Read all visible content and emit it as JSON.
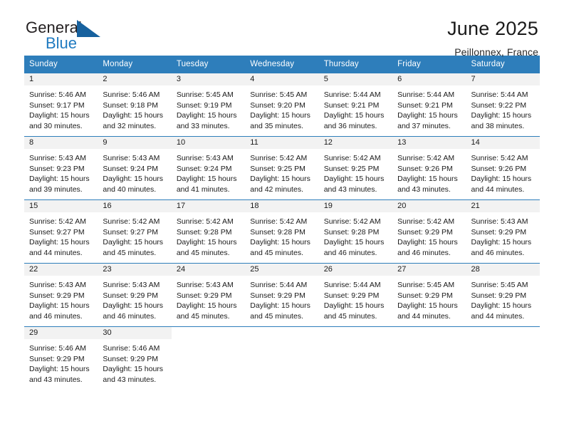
{
  "brand": {
    "name_top": "General",
    "name_bottom": "Blue",
    "accent_color": "#1f7ac0",
    "flag_color": "#17619e"
  },
  "header": {
    "title": "June 2025",
    "subtitle": "Peillonnex, France"
  },
  "theme": {
    "header_bg": "#2e7ebb",
    "daynum_bg": "#f2f2f2",
    "text_color": "#1a1a1a"
  },
  "calendar": {
    "weekday_headers": [
      "Sunday",
      "Monday",
      "Tuesday",
      "Wednesday",
      "Thursday",
      "Friday",
      "Saturday"
    ],
    "weeks": [
      [
        {
          "day": "1",
          "sunrise": "Sunrise: 5:46 AM",
          "sunset": "Sunset: 9:17 PM",
          "daylight_line1": "Daylight: 15 hours",
          "daylight_line2": "and 30 minutes."
        },
        {
          "day": "2",
          "sunrise": "Sunrise: 5:46 AM",
          "sunset": "Sunset: 9:18 PM",
          "daylight_line1": "Daylight: 15 hours",
          "daylight_line2": "and 32 minutes."
        },
        {
          "day": "3",
          "sunrise": "Sunrise: 5:45 AM",
          "sunset": "Sunset: 9:19 PM",
          "daylight_line1": "Daylight: 15 hours",
          "daylight_line2": "and 33 minutes."
        },
        {
          "day": "4",
          "sunrise": "Sunrise: 5:45 AM",
          "sunset": "Sunset: 9:20 PM",
          "daylight_line1": "Daylight: 15 hours",
          "daylight_line2": "and 35 minutes."
        },
        {
          "day": "5",
          "sunrise": "Sunrise: 5:44 AM",
          "sunset": "Sunset: 9:21 PM",
          "daylight_line1": "Daylight: 15 hours",
          "daylight_line2": "and 36 minutes."
        },
        {
          "day": "6",
          "sunrise": "Sunrise: 5:44 AM",
          "sunset": "Sunset: 9:21 PM",
          "daylight_line1": "Daylight: 15 hours",
          "daylight_line2": "and 37 minutes."
        },
        {
          "day": "7",
          "sunrise": "Sunrise: 5:44 AM",
          "sunset": "Sunset: 9:22 PM",
          "daylight_line1": "Daylight: 15 hours",
          "daylight_line2": "and 38 minutes."
        }
      ],
      [
        {
          "day": "8",
          "sunrise": "Sunrise: 5:43 AM",
          "sunset": "Sunset: 9:23 PM",
          "daylight_line1": "Daylight: 15 hours",
          "daylight_line2": "and 39 minutes."
        },
        {
          "day": "9",
          "sunrise": "Sunrise: 5:43 AM",
          "sunset": "Sunset: 9:24 PM",
          "daylight_line1": "Daylight: 15 hours",
          "daylight_line2": "and 40 minutes."
        },
        {
          "day": "10",
          "sunrise": "Sunrise: 5:43 AM",
          "sunset": "Sunset: 9:24 PM",
          "daylight_line1": "Daylight: 15 hours",
          "daylight_line2": "and 41 minutes."
        },
        {
          "day": "11",
          "sunrise": "Sunrise: 5:42 AM",
          "sunset": "Sunset: 9:25 PM",
          "daylight_line1": "Daylight: 15 hours",
          "daylight_line2": "and 42 minutes."
        },
        {
          "day": "12",
          "sunrise": "Sunrise: 5:42 AM",
          "sunset": "Sunset: 9:25 PM",
          "daylight_line1": "Daylight: 15 hours",
          "daylight_line2": "and 43 minutes."
        },
        {
          "day": "13",
          "sunrise": "Sunrise: 5:42 AM",
          "sunset": "Sunset: 9:26 PM",
          "daylight_line1": "Daylight: 15 hours",
          "daylight_line2": "and 43 minutes."
        },
        {
          "day": "14",
          "sunrise": "Sunrise: 5:42 AM",
          "sunset": "Sunset: 9:26 PM",
          "daylight_line1": "Daylight: 15 hours",
          "daylight_line2": "and 44 minutes."
        }
      ],
      [
        {
          "day": "15",
          "sunrise": "Sunrise: 5:42 AM",
          "sunset": "Sunset: 9:27 PM",
          "daylight_line1": "Daylight: 15 hours",
          "daylight_line2": "and 44 minutes."
        },
        {
          "day": "16",
          "sunrise": "Sunrise: 5:42 AM",
          "sunset": "Sunset: 9:27 PM",
          "daylight_line1": "Daylight: 15 hours",
          "daylight_line2": "and 45 minutes."
        },
        {
          "day": "17",
          "sunrise": "Sunrise: 5:42 AM",
          "sunset": "Sunset: 9:28 PM",
          "daylight_line1": "Daylight: 15 hours",
          "daylight_line2": "and 45 minutes."
        },
        {
          "day": "18",
          "sunrise": "Sunrise: 5:42 AM",
          "sunset": "Sunset: 9:28 PM",
          "daylight_line1": "Daylight: 15 hours",
          "daylight_line2": "and 45 minutes."
        },
        {
          "day": "19",
          "sunrise": "Sunrise: 5:42 AM",
          "sunset": "Sunset: 9:28 PM",
          "daylight_line1": "Daylight: 15 hours",
          "daylight_line2": "and 46 minutes."
        },
        {
          "day": "20",
          "sunrise": "Sunrise: 5:42 AM",
          "sunset": "Sunset: 9:29 PM",
          "daylight_line1": "Daylight: 15 hours",
          "daylight_line2": "and 46 minutes."
        },
        {
          "day": "21",
          "sunrise": "Sunrise: 5:43 AM",
          "sunset": "Sunset: 9:29 PM",
          "daylight_line1": "Daylight: 15 hours",
          "daylight_line2": "and 46 minutes."
        }
      ],
      [
        {
          "day": "22",
          "sunrise": "Sunrise: 5:43 AM",
          "sunset": "Sunset: 9:29 PM",
          "daylight_line1": "Daylight: 15 hours",
          "daylight_line2": "and 46 minutes."
        },
        {
          "day": "23",
          "sunrise": "Sunrise: 5:43 AM",
          "sunset": "Sunset: 9:29 PM",
          "daylight_line1": "Daylight: 15 hours",
          "daylight_line2": "and 46 minutes."
        },
        {
          "day": "24",
          "sunrise": "Sunrise: 5:43 AM",
          "sunset": "Sunset: 9:29 PM",
          "daylight_line1": "Daylight: 15 hours",
          "daylight_line2": "and 45 minutes."
        },
        {
          "day": "25",
          "sunrise": "Sunrise: 5:44 AM",
          "sunset": "Sunset: 9:29 PM",
          "daylight_line1": "Daylight: 15 hours",
          "daylight_line2": "and 45 minutes."
        },
        {
          "day": "26",
          "sunrise": "Sunrise: 5:44 AM",
          "sunset": "Sunset: 9:29 PM",
          "daylight_line1": "Daylight: 15 hours",
          "daylight_line2": "and 45 minutes."
        },
        {
          "day": "27",
          "sunrise": "Sunrise: 5:45 AM",
          "sunset": "Sunset: 9:29 PM",
          "daylight_line1": "Daylight: 15 hours",
          "daylight_line2": "and 44 minutes."
        },
        {
          "day": "28",
          "sunrise": "Sunrise: 5:45 AM",
          "sunset": "Sunset: 9:29 PM",
          "daylight_line1": "Daylight: 15 hours",
          "daylight_line2": "and 44 minutes."
        }
      ],
      [
        {
          "day": "29",
          "sunrise": "Sunrise: 5:46 AM",
          "sunset": "Sunset: 9:29 PM",
          "daylight_line1": "Daylight: 15 hours",
          "daylight_line2": "and 43 minutes."
        },
        {
          "day": "30",
          "sunrise": "Sunrise: 5:46 AM",
          "sunset": "Sunset: 9:29 PM",
          "daylight_line1": "Daylight: 15 hours",
          "daylight_line2": "and 43 minutes."
        },
        {
          "day": "",
          "sunrise": "",
          "sunset": "",
          "daylight_line1": "",
          "daylight_line2": ""
        },
        {
          "day": "",
          "sunrise": "",
          "sunset": "",
          "daylight_line1": "",
          "daylight_line2": ""
        },
        {
          "day": "",
          "sunrise": "",
          "sunset": "",
          "daylight_line1": "",
          "daylight_line2": ""
        },
        {
          "day": "",
          "sunrise": "",
          "sunset": "",
          "daylight_line1": "",
          "daylight_line2": ""
        },
        {
          "day": "",
          "sunrise": "",
          "sunset": "",
          "daylight_line1": "",
          "daylight_line2": ""
        }
      ]
    ]
  }
}
